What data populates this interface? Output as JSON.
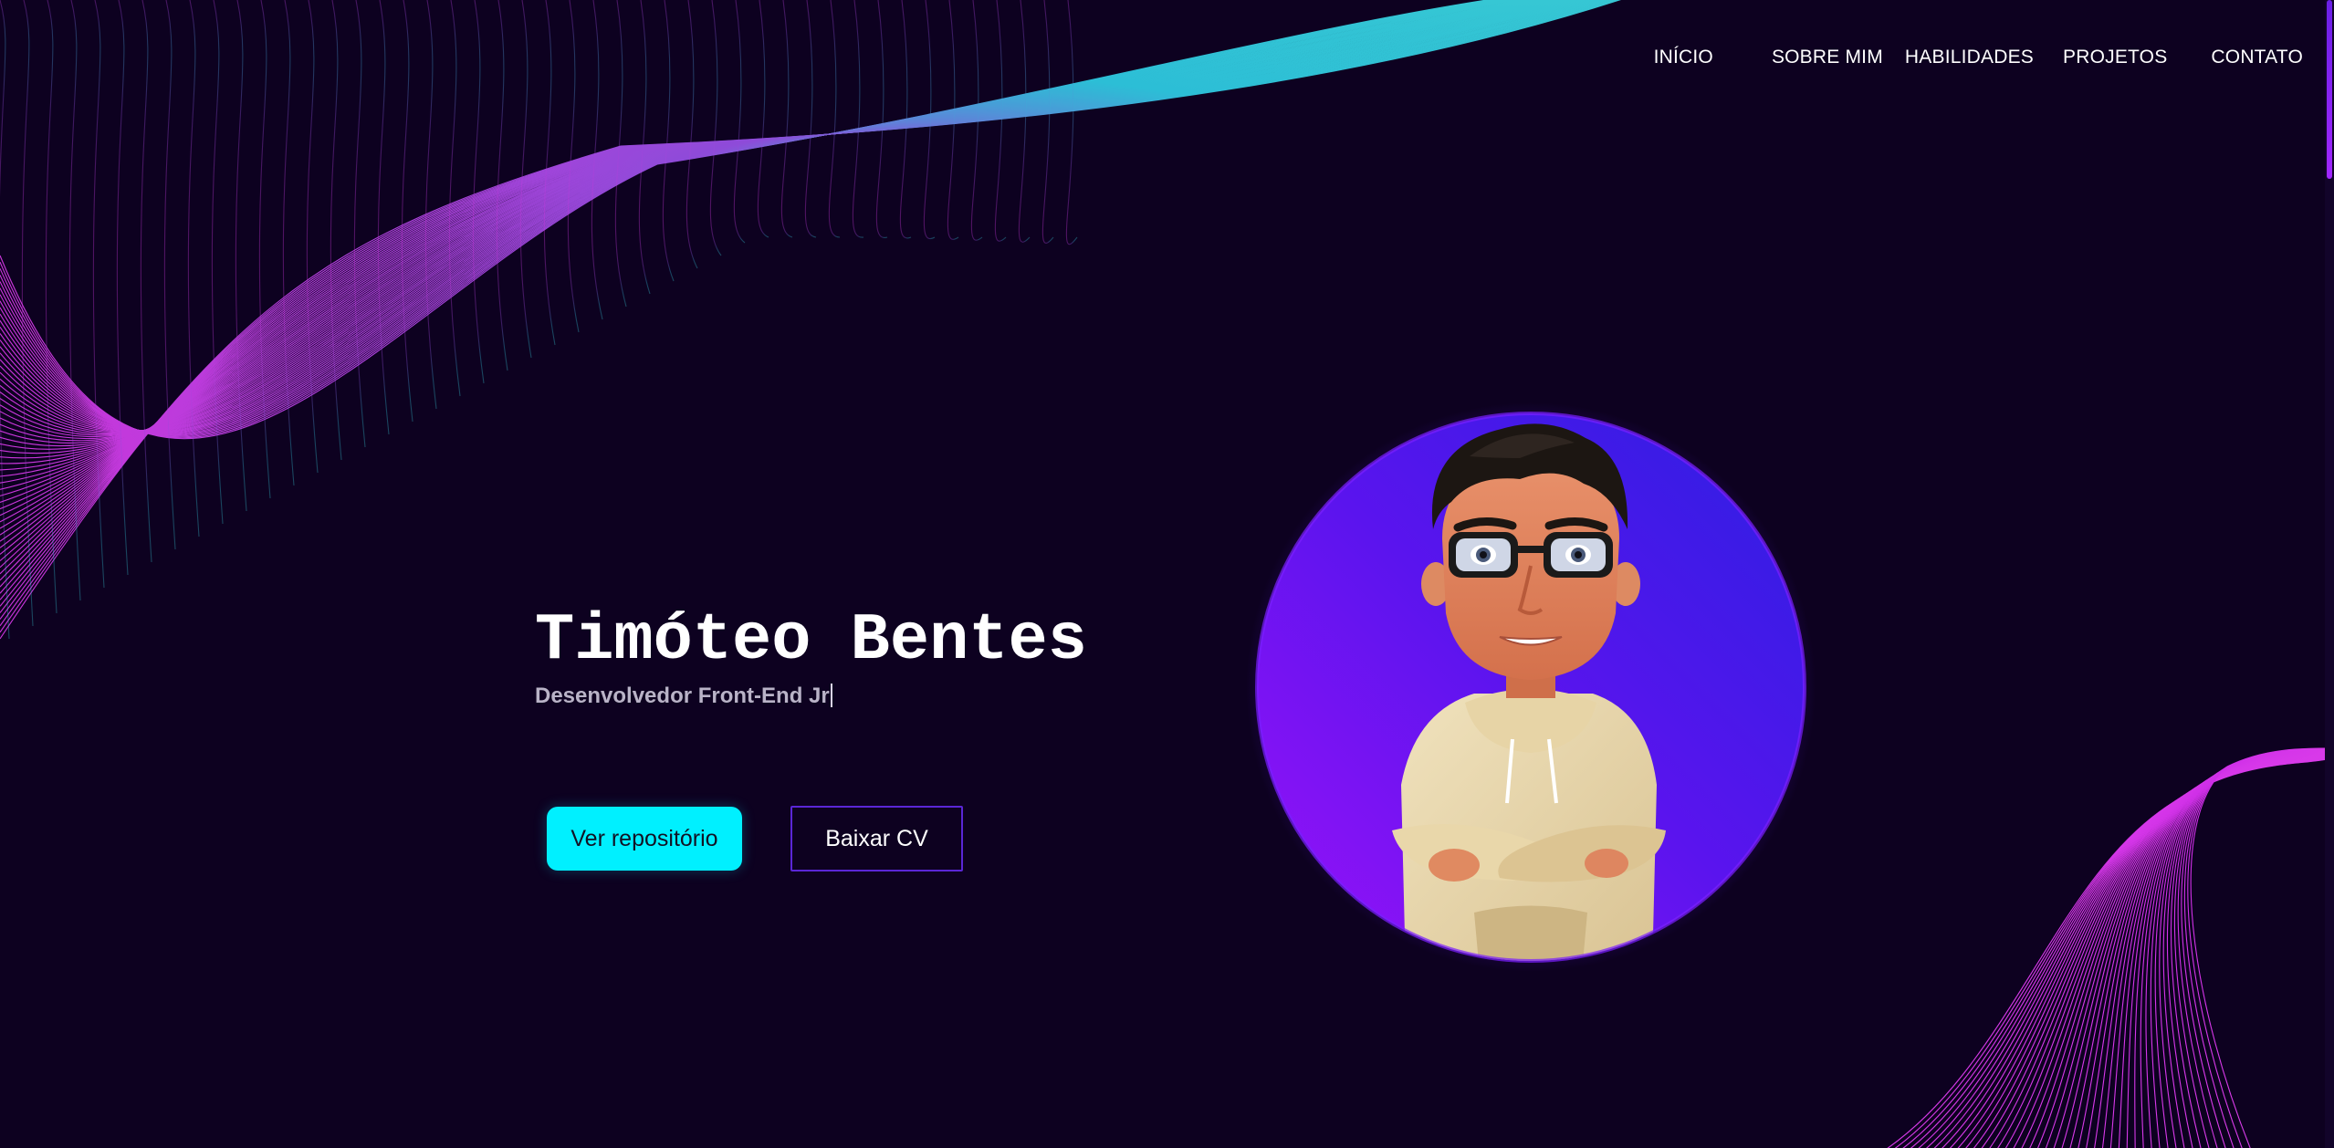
{
  "nav": {
    "items": [
      {
        "label": "INÍCIO"
      },
      {
        "label": "SOBRE MIM"
      },
      {
        "label": "HABILIDADES"
      },
      {
        "label": "PROJETOS"
      },
      {
        "label": "CONTATO"
      }
    ]
  },
  "hero": {
    "name": "Timóteo Bentes",
    "subtitle": "Desenvolvedor Front-End Jr",
    "buttons": {
      "repository": "Ver repositório",
      "cv": "Baixar CV"
    }
  },
  "colors": {
    "background": "#0d0120",
    "accent_cyan": "#00f0ff",
    "accent_purple": "#8a12f5",
    "wave_magenta": "#d535f2",
    "wave_cyan": "#2fd6e8"
  },
  "avatar": {
    "icon": "avatar-3d-icon"
  }
}
